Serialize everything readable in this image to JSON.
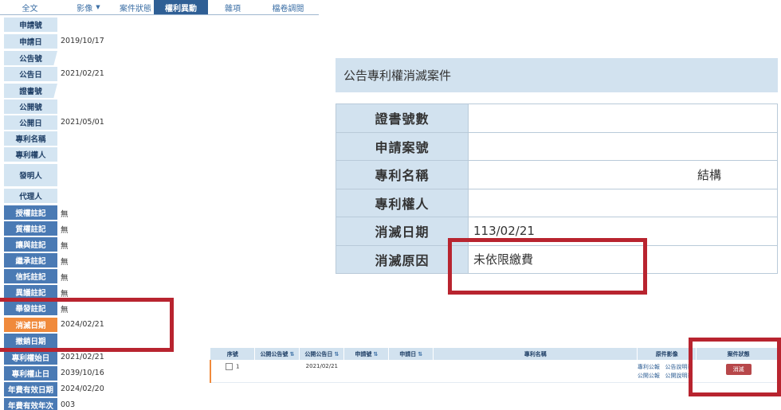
{
  "tabs": [
    {
      "label": "全文",
      "active": false
    },
    {
      "label": "影像",
      "active": false,
      "has_dropdown": true
    },
    {
      "label": "案件狀態",
      "active": false
    },
    {
      "label": "權利異動",
      "active": true
    },
    {
      "label": "雜項",
      "active": false
    },
    {
      "label": "檔卷調閱",
      "active": false
    }
  ],
  "detail": [
    {
      "label": "申請號",
      "value": "",
      "style": "light"
    },
    {
      "label": "申請日",
      "value": "2019/10/17",
      "style": "light"
    },
    {
      "label": "公告號",
      "value": "",
      "style": "light"
    },
    {
      "label": "公告日",
      "value": "2021/02/21",
      "style": "light"
    },
    {
      "label": "證書號",
      "value": "",
      "style": "light"
    },
    {
      "label": "公開號",
      "value": "",
      "style": "light"
    },
    {
      "label": "公開日",
      "value": "2021/05/01",
      "style": "light"
    },
    {
      "label": "專利名稱",
      "value": "",
      "style": "light"
    },
    {
      "label": "專利權人",
      "value": "",
      "style": "light"
    },
    {
      "label": "發明人",
      "value": "",
      "style": "light"
    },
    {
      "label": "代理人",
      "value": "",
      "style": "light"
    },
    {
      "label": "授權註記",
      "value": "無",
      "style": "dark"
    },
    {
      "label": "質權註記",
      "value": "無",
      "style": "dark"
    },
    {
      "label": "讓與註記",
      "value": "無",
      "style": "dark"
    },
    {
      "label": "繼承註記",
      "value": "無",
      "style": "dark"
    },
    {
      "label": "信託註記",
      "value": "無",
      "style": "dark"
    },
    {
      "label": "異議註記",
      "value": "無",
      "style": "dark"
    },
    {
      "label": "舉發註記",
      "value": "無",
      "style": "dark"
    },
    {
      "label": "消滅日期",
      "value": "2024/02/21",
      "style": "orange"
    },
    {
      "label": "撤銷日期",
      "value": "",
      "style": "dark"
    },
    {
      "label": "專利權始日",
      "value": "2021/02/21",
      "style": "dark"
    },
    {
      "label": "專利權止日",
      "value": "2039/10/16",
      "style": "dark"
    },
    {
      "label": "年費有效日期",
      "value": "2024/02/20",
      "style": "dark"
    },
    {
      "label": "年費有效年次",
      "value": "003",
      "style": "dark"
    }
  ],
  "panel": {
    "title": "公告專利權消滅案件",
    "rows": [
      {
        "label": "證書號數",
        "value": ""
      },
      {
        "label": "申請案號",
        "value": ""
      },
      {
        "label": "專利名稱",
        "value": "結構"
      },
      {
        "label": "專利權人",
        "value": ""
      },
      {
        "label": "消滅日期",
        "value": "113/02/21"
      },
      {
        "label": "消滅原因",
        "value": "未依限繳費"
      }
    ]
  },
  "results": {
    "headers": [
      "序號",
      "公開公告號",
      "公開公告日",
      "申請號",
      "申請日",
      "專利名稱",
      "原件影像",
      "案件狀態"
    ],
    "row": {
      "index": "1",
      "pub_no": "",
      "pub_date": "2021/02/21",
      "app_no": "",
      "app_date": "",
      "title": "",
      "image_links": [
        "專利公報",
        "公告說明書",
        "公開公報",
        "公開說明書"
      ],
      "status": "消滅"
    }
  },
  "colors": {
    "highlight": "#b8242f",
    "label_light": "#d4e5f2",
    "label_dark": "#4a7ab4",
    "label_orange": "#f08a3c",
    "status_button": "#b7474a"
  }
}
